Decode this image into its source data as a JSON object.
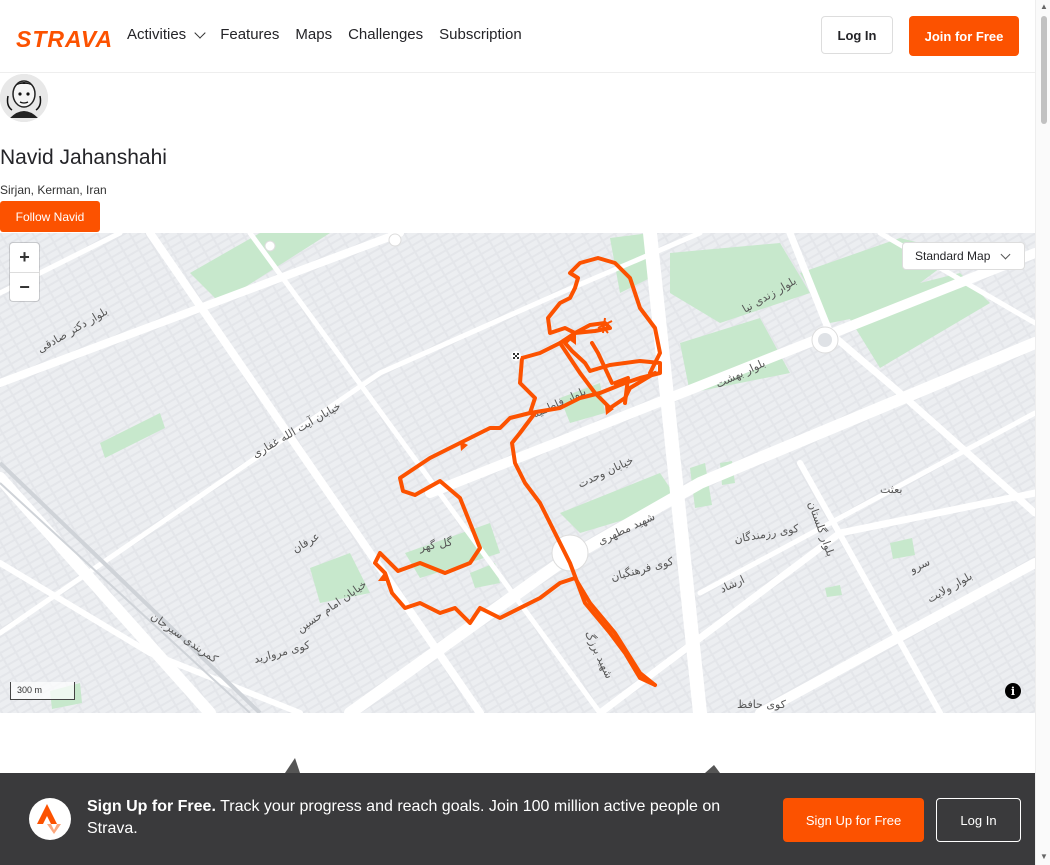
{
  "header": {
    "logo": "STRAVA",
    "nav": [
      "Activities",
      "Features",
      "Maps",
      "Challenges",
      "Subscription"
    ],
    "login": "Log In",
    "join": "Join for Free"
  },
  "profile": {
    "name": "Navid Jahanshahi",
    "location": "Sirjan, Kerman, Iran",
    "follow": "Follow Navid"
  },
  "map": {
    "style_select": "Standard Map",
    "zoom_in": "+",
    "zoom_out": "−",
    "scale": "300 m",
    "info": "i",
    "route_color": "#fc5200",
    "labels": {
      "l1": "بلوار دکتر صادقی",
      "l2": "خیابان آیت الله غفاری",
      "l3": "بلوار فاطمیه",
      "l4": "بلوار بهشت",
      "l5": "بلوار زندی نیا",
      "l6": "خیابان وحدت",
      "l7": "شهید مطهری",
      "l8": "کوی فرهنگیان",
      "l9": "کوی رزمندگان",
      "l10": "بلوار گلستان",
      "l11": "بلوار ولایت",
      "l12": "خیابان امام حسین",
      "l13": "کمربندی سیرجان",
      "l14": "کوی حافظ",
      "l15": "گل گهر",
      "l16": "عرفان",
      "l17": "بعثت",
      "l18": "سرو",
      "l19": "ارشاد",
      "l20": "کوی مروارید",
      "l21": "شهید برزگ"
    }
  },
  "banner": {
    "bold": "Sign Up for Free.",
    "text": " Track your progress and reach goals. Join 100 million active people on Strava.",
    "signup": "Sign Up for Free",
    "login": "Log In"
  }
}
